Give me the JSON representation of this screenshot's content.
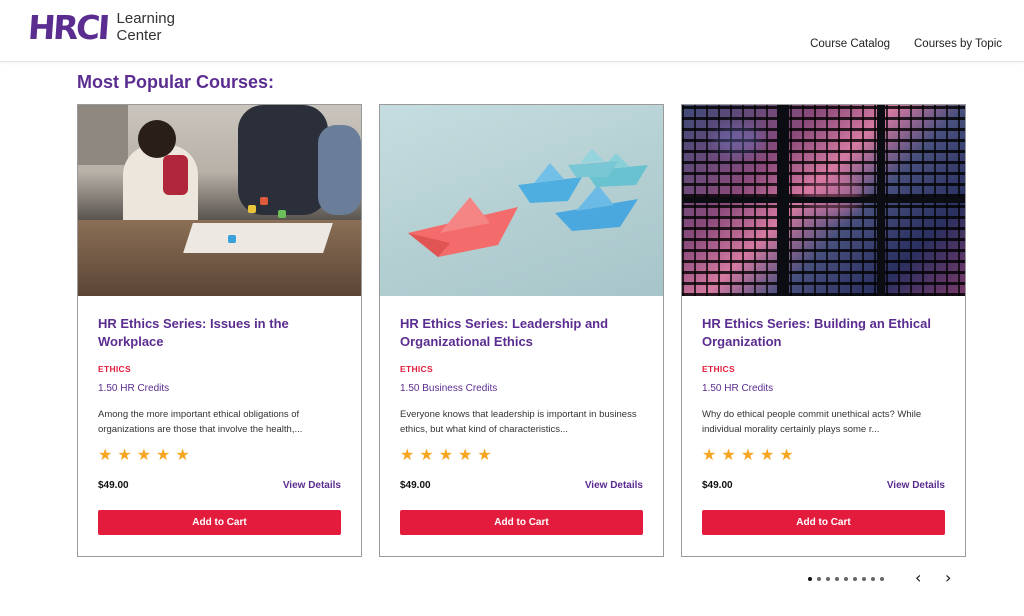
{
  "header": {
    "logo_mark": "HRCI",
    "logo_text_line1": "Learning",
    "logo_text_line2": "Center",
    "nav": [
      "Course Catalog",
      "Courses by Topic"
    ]
  },
  "section_title": "Most Popular Courses:",
  "courses": [
    {
      "title": "HR Ethics Series: Issues in the Workplace",
      "category": "ETHICS",
      "credits": "1.50 HR Credits",
      "description": "Among the more important ethical obligations of organizations are those that involve the health,...",
      "rating": 5,
      "price": "$49.00",
      "details_label": "View Details",
      "cart_label": "Add to Cart",
      "image": "workplace-meeting-photo"
    },
    {
      "title": "HR Ethics Series: Leadership and Organizational Ethics",
      "category": "ETHICS",
      "credits": "1.50 Business Credits",
      "description": "Everyone knows that leadership is important in business ethics, but what kind of characteristics...",
      "rating": 5,
      "price": "$49.00",
      "details_label": "View Details",
      "cart_label": "Add to Cart",
      "image": "paper-boats-photo"
    },
    {
      "title": "HR Ethics Series: Building an Ethical Organization",
      "category": "ETHICS",
      "credits": "1.50 HR Credits",
      "description": "Why do ethical people commit unethical acts? While individual morality certainly plays some r...",
      "rating": 5,
      "price": "$49.00",
      "details_label": "View Details",
      "cart_label": "Add to Cart",
      "image": "office-building-night-photo"
    }
  ],
  "pagination": {
    "page_count": 9,
    "active_page": 1,
    "prev_icon": "chevron-left-icon",
    "next_icon": "chevron-right-icon"
  },
  "colors": {
    "brand_purple": "#5b2d90",
    "accent_red": "#e31c3d",
    "star_orange": "#f6a623"
  }
}
